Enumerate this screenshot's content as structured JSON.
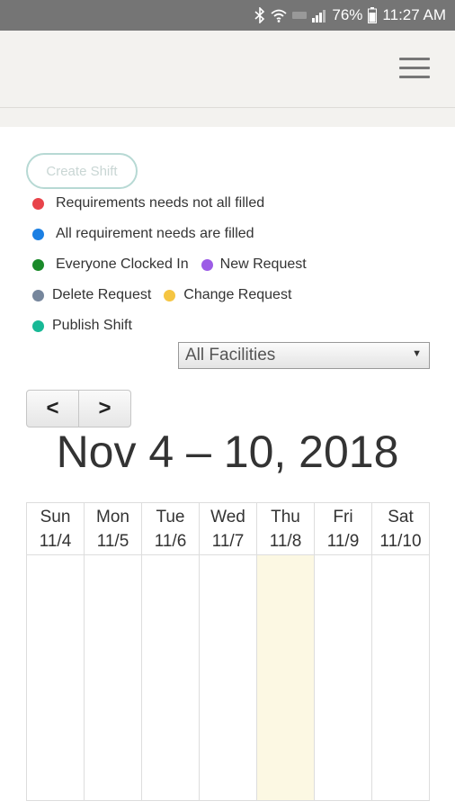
{
  "status_bar": {
    "battery": "76%",
    "time": "11:27 AM"
  },
  "actions": {
    "create_shift_label": "Create Shift"
  },
  "legend": {
    "requirements_not_filled": {
      "label": "Requirements needs not all filled",
      "color": "#e8434a"
    },
    "requirements_filled": {
      "label": "All requirement needs are filled",
      "color": "#1b7fe3"
    },
    "everyone_clocked_in": {
      "label": "Everyone Clocked In",
      "color": "#1a8a2a"
    },
    "new_request": {
      "label": "New Request",
      "color": "#9c5ce6"
    },
    "delete_request": {
      "label": "Delete Request",
      "color": "#76869c"
    },
    "change_request": {
      "label": "Change Request",
      "color": "#f5c542"
    },
    "publish_shift": {
      "label": "Publish Shift",
      "color": "#18b996"
    }
  },
  "facility_filter": {
    "selected": "All Facilities"
  },
  "nav": {
    "prev_label": "<",
    "next_label": ">"
  },
  "calendar": {
    "title": "Nov 4 – 10, 2018",
    "days": [
      {
        "name": "Sun",
        "date": "11/4"
      },
      {
        "name": "Mon",
        "date": "11/5"
      },
      {
        "name": "Tue",
        "date": "11/6"
      },
      {
        "name": "Wed",
        "date": "11/7"
      },
      {
        "name": "Thu",
        "date": "11/8"
      },
      {
        "name": "Fri",
        "date": "11/9"
      },
      {
        "name": "Sat",
        "date": "11/10"
      }
    ],
    "highlight_color": "#fcf8e3"
  },
  "icons": [
    "bluetooth-icon",
    "wifi-icon",
    "lte-icon",
    "signal-icon",
    "battery-icon",
    "hamburger-menu-icon"
  ]
}
